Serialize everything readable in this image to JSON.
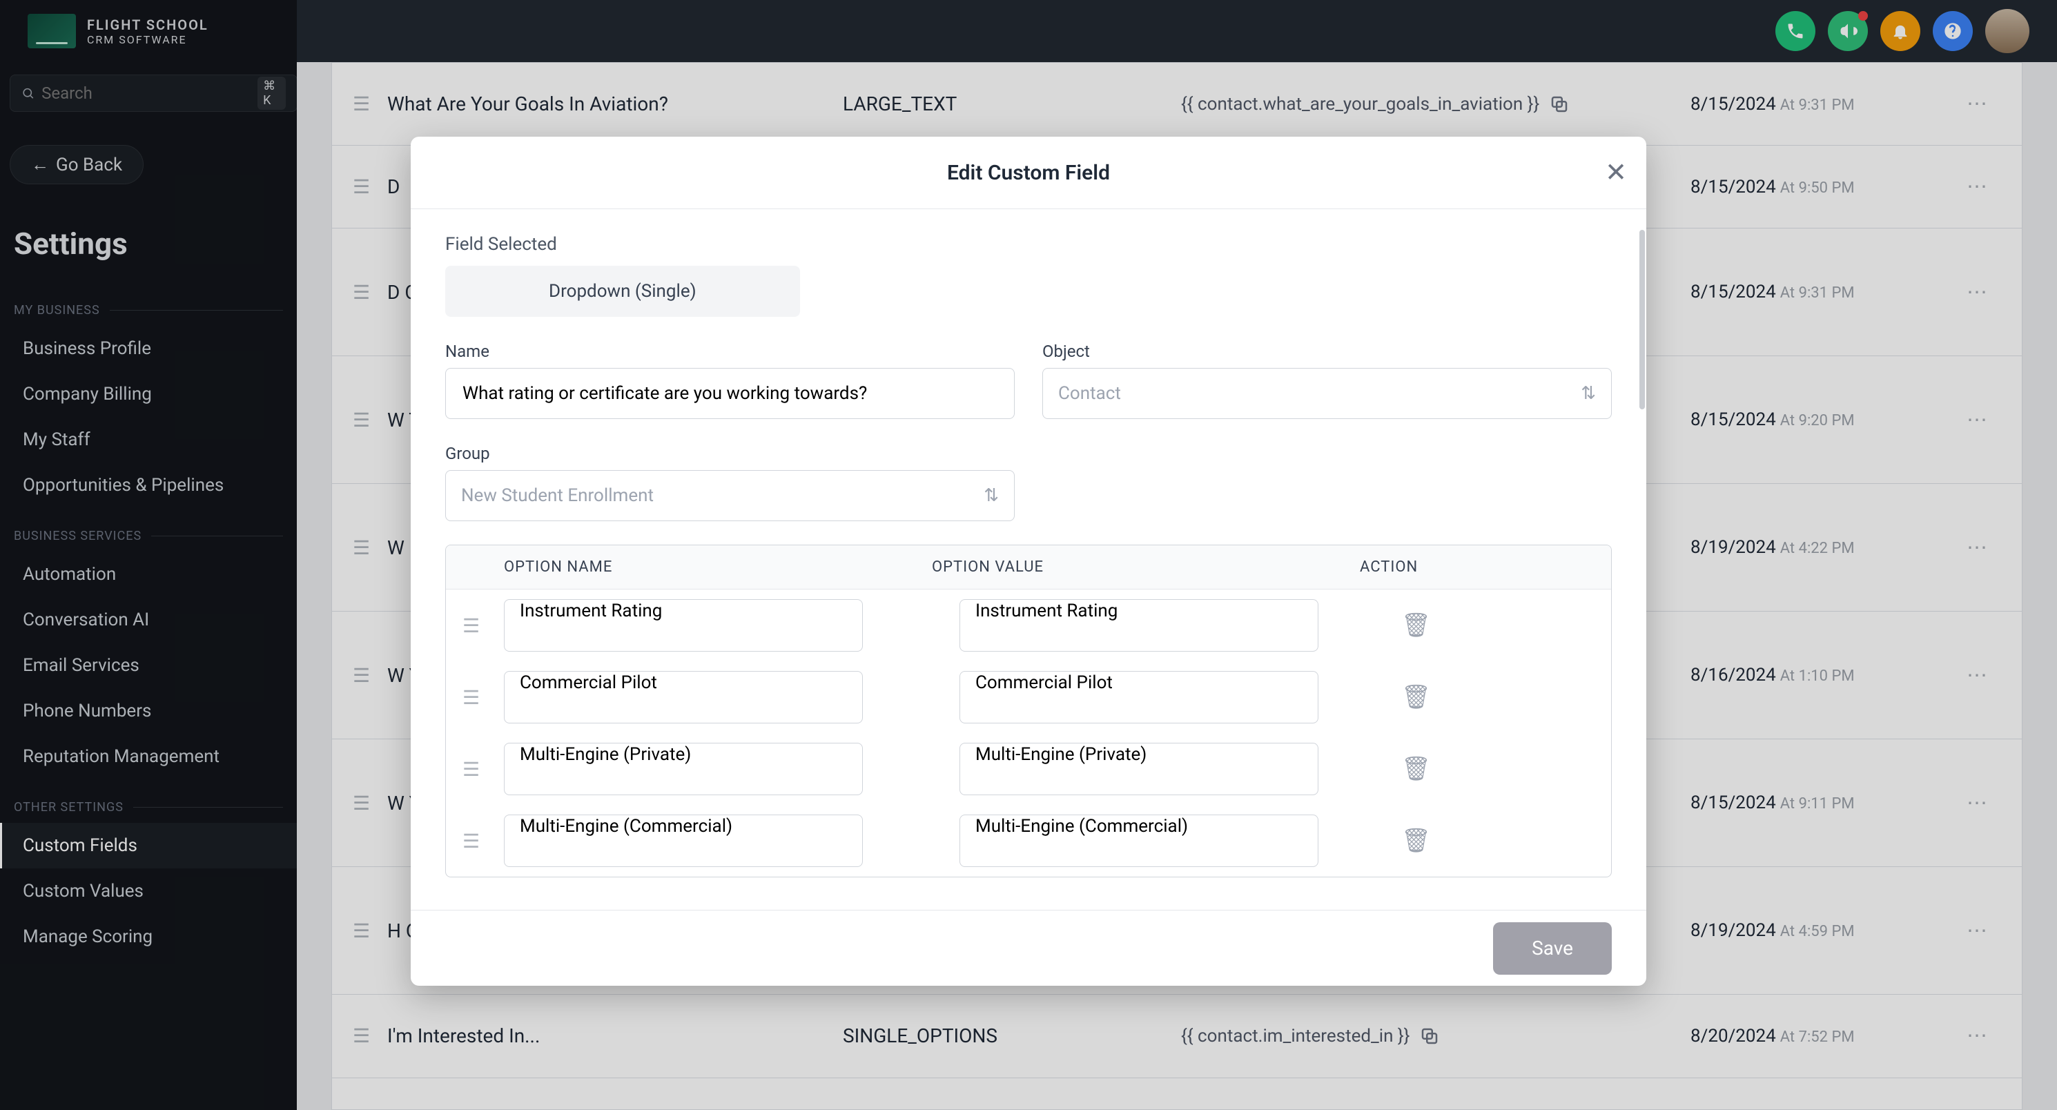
{
  "logo": {
    "line1": "FLIGHT SCHOOL",
    "line2": "CRM SOFTWARE"
  },
  "search": {
    "placeholder": "Search",
    "shortcut": "⌘ K"
  },
  "goback": "Go Back",
  "settings_heading": "Settings",
  "sections": {
    "my_business": "MY BUSINESS",
    "business_services": "BUSINESS SERVICES",
    "other_settings": "OTHER SETTINGS"
  },
  "nav": {
    "business_profile": "Business Profile",
    "company_billing": "Company Billing",
    "my_staff": "My Staff",
    "opportunities": "Opportunities & Pipelines",
    "automation": "Automation",
    "conversation_ai": "Conversation AI",
    "email_services": "Email Services",
    "phone_numbers": "Phone Numbers",
    "reputation": "Reputation Management",
    "custom_fields": "Custom Fields",
    "custom_values": "Custom Values",
    "manage_scoring": "Manage Scoring"
  },
  "rows": [
    {
      "name": "What Are Your Goals In Aviation?",
      "type": "LARGE_TEXT",
      "key": "{{ contact.what_are_your_goals_in_aviation }}",
      "date": "8/15/2024",
      "time": "At 9:31 PM"
    },
    {
      "name": "D",
      "type": "",
      "key": "",
      "date": "8/15/2024",
      "time": "At 9:50 PM"
    },
    {
      "name": "D C",
      "type": "",
      "key": "",
      "date": "8/15/2024",
      "time": "At 9:31 PM"
    },
    {
      "name": "W T",
      "type": "",
      "key": "",
      "date": "8/15/2024",
      "time": "At 9:20 PM"
    },
    {
      "name": "W",
      "type": "",
      "key": "",
      "date": "8/19/2024",
      "time": "At 4:22 PM"
    },
    {
      "name": "W Y",
      "type": "",
      "key": "",
      "date": "8/16/2024",
      "time": "At 1:10 PM"
    },
    {
      "name": "W Y",
      "type": "",
      "key": "",
      "date": "8/15/2024",
      "time": "At 9:11 PM"
    },
    {
      "name": "H O",
      "type": "",
      "key": "}}",
      "date": "8/19/2024",
      "time": "At 4:59 PM"
    },
    {
      "name": "I'm Interested In...",
      "type": "SINGLE_OPTIONS",
      "key": "{{ contact.im_interested_in }}",
      "date": "8/20/2024",
      "time": "At 7:52 PM"
    }
  ],
  "modal": {
    "title": "Edit Custom Field",
    "field_selected_label": "Field Selected",
    "field_selected_value": "Dropdown (Single)",
    "name_label": "Name",
    "name_value": "What rating or certificate are you working towards?",
    "object_label": "Object",
    "object_value": "Contact",
    "group_label": "Group",
    "group_value": "New Student Enrollment",
    "col_option_name": "OPTION NAME",
    "col_option_value": "OPTION VALUE",
    "col_action": "ACTION",
    "options": [
      {
        "name": "Instrument Rating",
        "value": "Instrument Rating"
      },
      {
        "name": "Commercial Pilot",
        "value": "Commercial Pilot"
      },
      {
        "name": "Multi-Engine (Private)",
        "value": "Multi-Engine (Private)"
      },
      {
        "name": "Multi-Engine (Commercial)",
        "value": "Multi-Engine (Commercial)"
      }
    ],
    "save": "Save"
  }
}
